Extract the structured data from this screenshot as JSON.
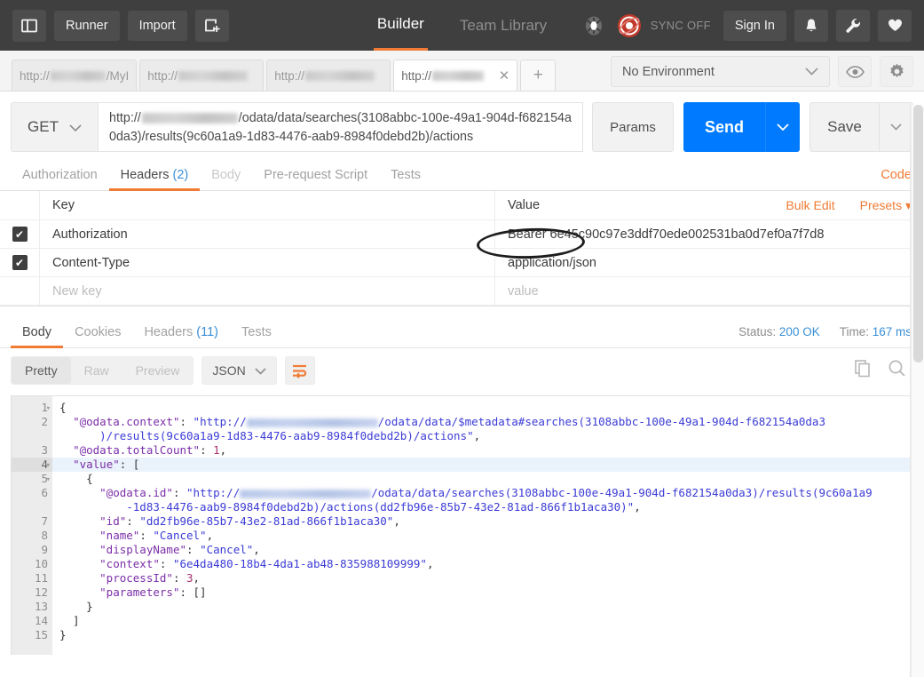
{
  "topbar": {
    "sidebar_toggle_icon": "sidebar-panel-icon",
    "runner_label": "Runner",
    "import_label": "Import",
    "new_window_icon": "new-window-plus-icon",
    "tabs": [
      {
        "label": "Builder",
        "active": true
      },
      {
        "label": "Team Library",
        "active": false
      }
    ],
    "bug_icon": "bug-icon",
    "sync_icon": "sync-status-icon",
    "sync_label": "SYNC OFF",
    "signin_label": "Sign In",
    "bell_icon": "bell-icon",
    "wrench_icon": "wrench-icon",
    "heart_icon": "heart-icon"
  },
  "request_tabs": {
    "items": [
      {
        "prefix": "http://",
        "suffix": "/MyI",
        "active": false
      },
      {
        "prefix": "http://",
        "suffix": "",
        "active": false
      },
      {
        "prefix": "http://",
        "suffix": "",
        "active": false
      },
      {
        "prefix": "http://",
        "suffix": "",
        "active": true
      }
    ],
    "close_label": "✕",
    "add_label": "+"
  },
  "environment": {
    "selected": "No Environment",
    "chevron_icon": "chevron-down-icon",
    "eye_icon": "eye-icon",
    "gear_icon": "gear-icon"
  },
  "url_bar": {
    "method": "GET",
    "method_chevron_icon": "chevron-down-icon",
    "url_prefix": "http://",
    "url_line1_tail": "/odata/data/searches(3108abbc-100e-49a1-904d-",
    "url_line2": "f682154a0da3)/results(9c60a1a9-1d83-4476-aab9-8984f0debd2b)/actions",
    "params_label": "Params",
    "send_label": "Send",
    "send_caret_icon": "chevron-down-icon",
    "save_label": "Save",
    "save_caret_icon": "chevron-down-icon",
    "annotation": "ellipse-highlight-around-d2b-actions"
  },
  "request_tabs_sub": {
    "items": [
      {
        "label": "Authorization",
        "count": "",
        "active": false,
        "dim": false
      },
      {
        "label": "Headers",
        "count": "(2)",
        "active": true,
        "dim": false
      },
      {
        "label": "Body",
        "count": "",
        "active": false,
        "dim": true
      },
      {
        "label": "Pre-request Script",
        "count": "",
        "active": false,
        "dim": false
      },
      {
        "label": "Tests",
        "count": "",
        "active": false,
        "dim": false
      }
    ],
    "code_label": "Code"
  },
  "headers_table": {
    "col_key": "Key",
    "col_value": "Value",
    "bulk_edit_label": "Bulk Edit",
    "presets_label": "Presets ▾",
    "check_glyph": "✔",
    "rows": [
      {
        "checked": true,
        "key": "Authorization",
        "value": "Bearer 6e45c90c97e3ddf70ede002531ba0d7ef0a7f7d8"
      },
      {
        "checked": true,
        "key": "Content-Type",
        "value": "application/json"
      }
    ],
    "new_row": {
      "key_placeholder": "New key",
      "value_placeholder": "value"
    }
  },
  "response": {
    "tabs": [
      {
        "label": "Body",
        "count": "",
        "active": true
      },
      {
        "label": "Cookies",
        "count": "",
        "active": false
      },
      {
        "label": "Headers",
        "count": "(11)",
        "active": false
      },
      {
        "label": "Tests",
        "count": "",
        "active": false
      }
    ],
    "status_label": "Status:",
    "status_value": "200 OK",
    "time_label": "Time:",
    "time_value": "167 ms",
    "view_modes": [
      {
        "label": "Pretty",
        "active": true
      },
      {
        "label": "Raw",
        "active": false
      },
      {
        "label": "Preview",
        "active": false
      }
    ],
    "format": "JSON",
    "format_chevron_icon": "chevron-down-icon",
    "wrap_icon": "word-wrap-icon",
    "copy_icon": "copy-icon",
    "search_icon": "search-icon"
  },
  "code": {
    "lines": [
      {
        "num": "1",
        "fold": true,
        "selected": false,
        "segments": [
          {
            "t": "{",
            "c": "p"
          }
        ]
      },
      {
        "num": "2",
        "fold": false,
        "selected": false,
        "segments": [
          {
            "t": "  ",
            "c": "p"
          },
          {
            "t": "\"@odata.context\"",
            "c": "k"
          },
          {
            "t": ": ",
            "c": "p"
          },
          {
            "t": "\"http://",
            "c": "s"
          },
          {
            "t": "[blur]",
            "c": "blur"
          },
          {
            "t": "/odata/data/$metadata#searches(3108abbc-100e-49a1-904d-f682154a0da3",
            "c": "s"
          }
        ]
      },
      {
        "num": "",
        "fold": false,
        "selected": false,
        "continuation": true,
        "segments": [
          {
            "t": "      )/results(9c60a1a9-1d83-4476-aab9-8984f0debd2b)/actions\"",
            "c": "s"
          },
          {
            "t": ",",
            "c": "p"
          }
        ]
      },
      {
        "num": "3",
        "fold": false,
        "selected": false,
        "segments": [
          {
            "t": "  ",
            "c": "p"
          },
          {
            "t": "\"@odata.totalCount\"",
            "c": "k"
          },
          {
            "t": ": ",
            "c": "p"
          },
          {
            "t": "1",
            "c": "n"
          },
          {
            "t": ",",
            "c": "p"
          }
        ]
      },
      {
        "num": "4",
        "fold": true,
        "selected": true,
        "segments": [
          {
            "t": "  ",
            "c": "p"
          },
          {
            "t": "\"value\"",
            "c": "k"
          },
          {
            "t": ": [",
            "c": "p"
          }
        ]
      },
      {
        "num": "5",
        "fold": true,
        "selected": false,
        "segments": [
          {
            "t": "    {",
            "c": "p"
          }
        ]
      },
      {
        "num": "6",
        "fold": false,
        "selected": false,
        "segments": [
          {
            "t": "      ",
            "c": "p"
          },
          {
            "t": "\"@odata.id\"",
            "c": "k"
          },
          {
            "t": ": ",
            "c": "p"
          },
          {
            "t": "\"http://",
            "c": "s"
          },
          {
            "t": "[blur]",
            "c": "blur"
          },
          {
            "t": "/odata/data/searches(3108abbc-100e-49a1-904d-f682154a0da3)/results(9c60a1a9",
            "c": "s"
          }
        ]
      },
      {
        "num": "",
        "fold": false,
        "selected": false,
        "continuation": true,
        "segments": [
          {
            "t": "          -1d83-4476-aab9-8984f0debd2b)/actions(dd2fb96e-85b7-43e2-81ad-866f1b1aca30)\"",
            "c": "s"
          },
          {
            "t": ",",
            "c": "p"
          }
        ]
      },
      {
        "num": "7",
        "fold": false,
        "selected": false,
        "segments": [
          {
            "t": "      ",
            "c": "p"
          },
          {
            "t": "\"id\"",
            "c": "k"
          },
          {
            "t": ": ",
            "c": "p"
          },
          {
            "t": "\"dd2fb96e-85b7-43e2-81ad-866f1b1aca30\"",
            "c": "s"
          },
          {
            "t": ",",
            "c": "p"
          }
        ]
      },
      {
        "num": "8",
        "fold": false,
        "selected": false,
        "segments": [
          {
            "t": "      ",
            "c": "p"
          },
          {
            "t": "\"name\"",
            "c": "k"
          },
          {
            "t": ": ",
            "c": "p"
          },
          {
            "t": "\"Cancel\"",
            "c": "s"
          },
          {
            "t": ",",
            "c": "p"
          }
        ]
      },
      {
        "num": "9",
        "fold": false,
        "selected": false,
        "segments": [
          {
            "t": "      ",
            "c": "p"
          },
          {
            "t": "\"displayName\"",
            "c": "k"
          },
          {
            "t": ": ",
            "c": "p"
          },
          {
            "t": "\"Cancel\"",
            "c": "s"
          },
          {
            "t": ",",
            "c": "p"
          }
        ]
      },
      {
        "num": "10",
        "fold": false,
        "selected": false,
        "segments": [
          {
            "t": "      ",
            "c": "p"
          },
          {
            "t": "\"context\"",
            "c": "k"
          },
          {
            "t": ": ",
            "c": "p"
          },
          {
            "t": "\"6e4da480-18b4-4da1-ab48-835988109999\"",
            "c": "s"
          },
          {
            "t": ",",
            "c": "p"
          }
        ]
      },
      {
        "num": "11",
        "fold": false,
        "selected": false,
        "segments": [
          {
            "t": "      ",
            "c": "p"
          },
          {
            "t": "\"processId\"",
            "c": "k"
          },
          {
            "t": ": ",
            "c": "p"
          },
          {
            "t": "3",
            "c": "n"
          },
          {
            "t": ",",
            "c": "p"
          }
        ]
      },
      {
        "num": "12",
        "fold": false,
        "selected": false,
        "segments": [
          {
            "t": "      ",
            "c": "p"
          },
          {
            "t": "\"parameters\"",
            "c": "k"
          },
          {
            "t": ": []",
            "c": "p"
          }
        ]
      },
      {
        "num": "13",
        "fold": false,
        "selected": false,
        "segments": [
          {
            "t": "    }",
            "c": "p"
          }
        ]
      },
      {
        "num": "14",
        "fold": false,
        "selected": false,
        "segments": [
          {
            "t": "  ]",
            "c": "p"
          }
        ]
      },
      {
        "num": "15",
        "fold": false,
        "selected": false,
        "segments": [
          {
            "t": "}",
            "c": "p"
          }
        ]
      }
    ]
  },
  "colors": {
    "accent_orange": "#f07b35",
    "send_blue": "#007bff",
    "status_blue": "#3a8fd6",
    "dark_chrome": "#3f3f3f"
  }
}
